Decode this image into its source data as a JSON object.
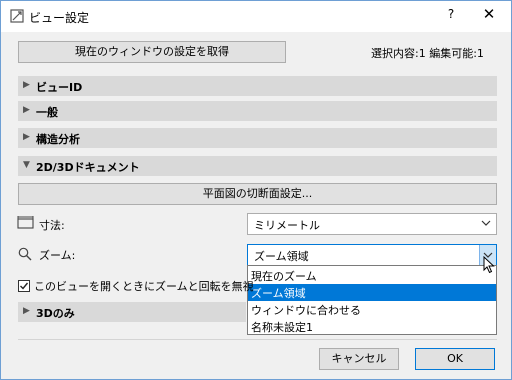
{
  "window": {
    "title": "ビュー設定",
    "help_label": "?",
    "close_label": "✕"
  },
  "top": {
    "get_settings_label": "現在のウィンドウの設定を取得",
    "selection_info": "選択内容:1 編集可能:1"
  },
  "sections": [
    {
      "label": "ビューID",
      "expanded": false
    },
    {
      "label": "一般",
      "expanded": false
    },
    {
      "label": "構造分析",
      "expanded": false
    },
    {
      "label": "2D/3Dドキュメント",
      "expanded": true
    }
  ],
  "doc": {
    "cut_plane_button": "平面図の切断面設定...",
    "dimension_label": "寸法:",
    "dimension_value": "ミリメートル",
    "zoom_label": "ズーム:",
    "zoom_value": "ズーム領域",
    "zoom_options": [
      "現在のズーム",
      "ズーム領域",
      "ウィンドウに合わせる",
      "名称未設定1"
    ],
    "zoom_highlighted_index": 1,
    "ignore_checkbox_label": "このビューを開くときにズームと回転を無視",
    "ignore_checked": true
  },
  "section_3d": {
    "label": "3Dのみ",
    "expanded": false
  },
  "footer": {
    "cancel_label": "キャンセル",
    "ok_label": "OK"
  },
  "colors": {
    "highlight": "#0078d7",
    "section_bg": "#d9d9d9",
    "window_bg": "#f0f0f0"
  }
}
